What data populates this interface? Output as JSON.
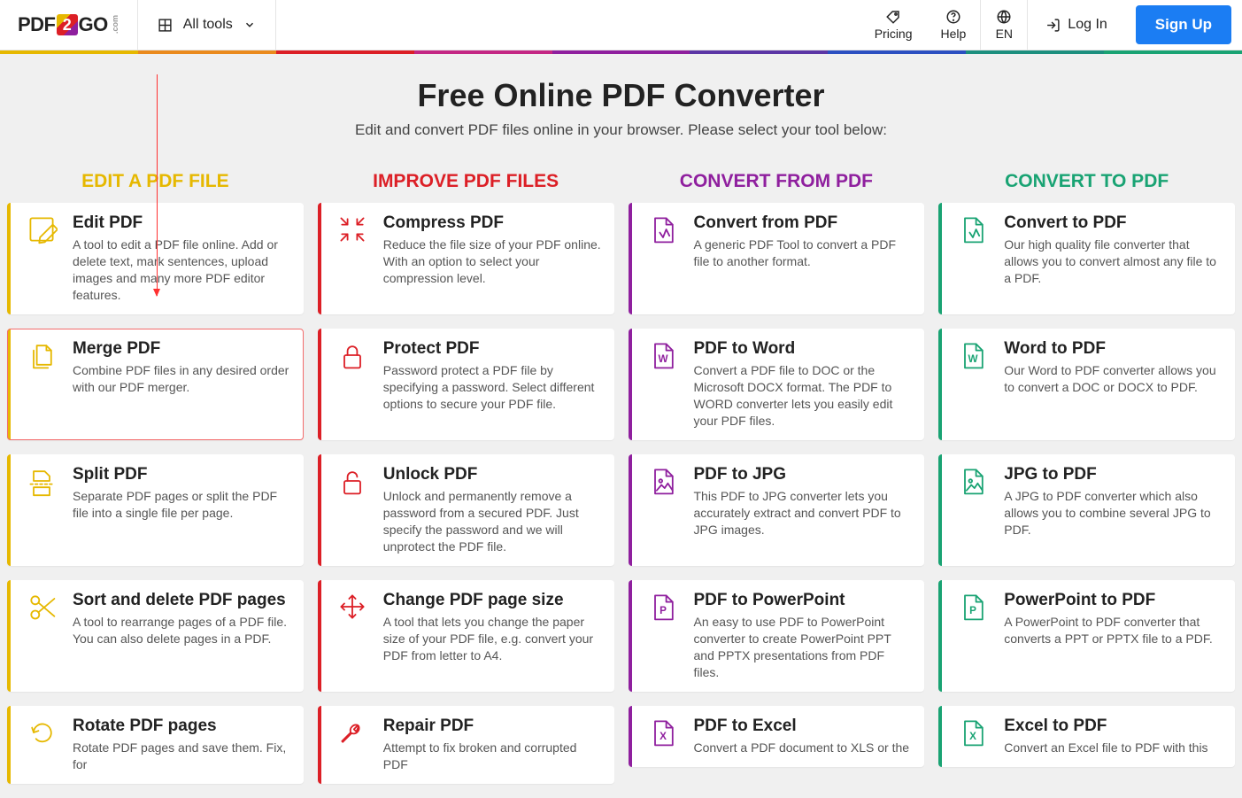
{
  "brand": {
    "name_pre": "PDF",
    "name_mid": "2",
    "name_post": "GO",
    "suffix": ".com"
  },
  "nav": {
    "all_tools": "All tools",
    "pricing": "Pricing",
    "help": "Help",
    "lang": "EN",
    "login": "Log In",
    "signup": "Sign Up"
  },
  "rainbow_colors": [
    "#e6b800",
    "#ea8a1d",
    "#dc1f26",
    "#c42784",
    "#8f1f9e",
    "#5c36a6",
    "#2b4fc1",
    "#1c8f7e",
    "#19a373"
  ],
  "hero": {
    "title": "Free Online PDF Converter",
    "subtitle": "Edit and convert PDF files online in your browser. Please select your tool below:"
  },
  "columns": [
    {
      "key": "edit",
      "title": "EDIT A PDF FILE",
      "color": "yellow"
    },
    {
      "key": "improve",
      "title": "IMPROVE PDF FILES",
      "color": "red"
    },
    {
      "key": "from",
      "title": "CONVERT FROM PDF",
      "color": "purple"
    },
    {
      "key": "to",
      "title": "CONVERT TO PDF",
      "color": "green"
    }
  ],
  "cards": {
    "edit": [
      {
        "icon": "pencil-square-icon",
        "title": "Edit PDF",
        "desc": "A tool to edit a PDF file online. Add or delete text, mark sentences, upload images and many more PDF editor features."
      },
      {
        "icon": "copy-files-icon",
        "title": "Merge PDF",
        "desc": "Combine PDF files in any desired order with our PDF merger.",
        "highlight": true
      },
      {
        "icon": "split-file-icon",
        "title": "Split PDF",
        "desc": "Separate PDF pages or split the PDF file into a single file per page."
      },
      {
        "icon": "scissors-icon",
        "title": "Sort and delete PDF pages",
        "desc": "A tool to rearrange pages of a PDF file. You can also delete pages in a PDF."
      },
      {
        "icon": "rotate-icon",
        "title": "Rotate PDF pages",
        "desc": "Rotate PDF pages and save them. Fix, for"
      }
    ],
    "improve": [
      {
        "icon": "compress-icon",
        "title": "Compress PDF",
        "desc": "Reduce the file size of your PDF online. With an option to select your compression level."
      },
      {
        "icon": "lock-icon",
        "title": "Protect PDF",
        "desc": "Password protect a PDF file by specifying a password. Select different options to secure your PDF file."
      },
      {
        "icon": "unlock-icon",
        "title": "Unlock PDF",
        "desc": "Unlock and permanently remove a password from a secured PDF. Just specify the password and we will unprotect the PDF file."
      },
      {
        "icon": "move-icon",
        "title": "Change PDF page size",
        "desc": "A tool that lets you change the paper size of your PDF file, e.g. convert your PDF from letter to A4."
      },
      {
        "icon": "wrench-icon",
        "title": "Repair PDF",
        "desc": "Attempt to fix broken and corrupted PDF"
      }
    ],
    "from": [
      {
        "icon": "file-pdf-icon",
        "title": "Convert from PDF",
        "desc": "A generic PDF Tool to convert a PDF file to another format."
      },
      {
        "icon": "file-w-icon",
        "title": "PDF to Word",
        "desc": "Convert a PDF file to DOC or the Microsoft DOCX format. The PDF to WORD converter lets you easily edit your PDF files."
      },
      {
        "icon": "file-img-icon",
        "title": "PDF to JPG",
        "desc": "This PDF to JPG converter lets you accurately extract and convert PDF to JPG images."
      },
      {
        "icon": "file-p-icon",
        "title": "PDF to PowerPoint",
        "desc": "An easy to use PDF to PowerPoint converter to create PowerPoint PPT and PPTX presentations from PDF files."
      },
      {
        "icon": "file-x-icon",
        "title": "PDF to Excel",
        "desc": "Convert a PDF document to XLS or the"
      }
    ],
    "to": [
      {
        "icon": "file-pdf-icon",
        "title": "Convert to PDF",
        "desc": "Our high quality file converter that allows you to convert almost any file to a PDF."
      },
      {
        "icon": "file-w-icon",
        "title": "Word to PDF",
        "desc": "Our Word to PDF converter allows you to convert a DOC or DOCX to PDF."
      },
      {
        "icon": "file-img-icon",
        "title": "JPG to PDF",
        "desc": "A JPG to PDF converter which also allows you to combine several JPG to PDF."
      },
      {
        "icon": "file-p-icon",
        "title": "PowerPoint to PDF",
        "desc": "A PowerPoint to PDF converter that converts a PPT or PPTX file to a PDF."
      },
      {
        "icon": "file-x-icon",
        "title": "Excel to PDF",
        "desc": "Convert an Excel file to PDF with this"
      }
    ]
  }
}
